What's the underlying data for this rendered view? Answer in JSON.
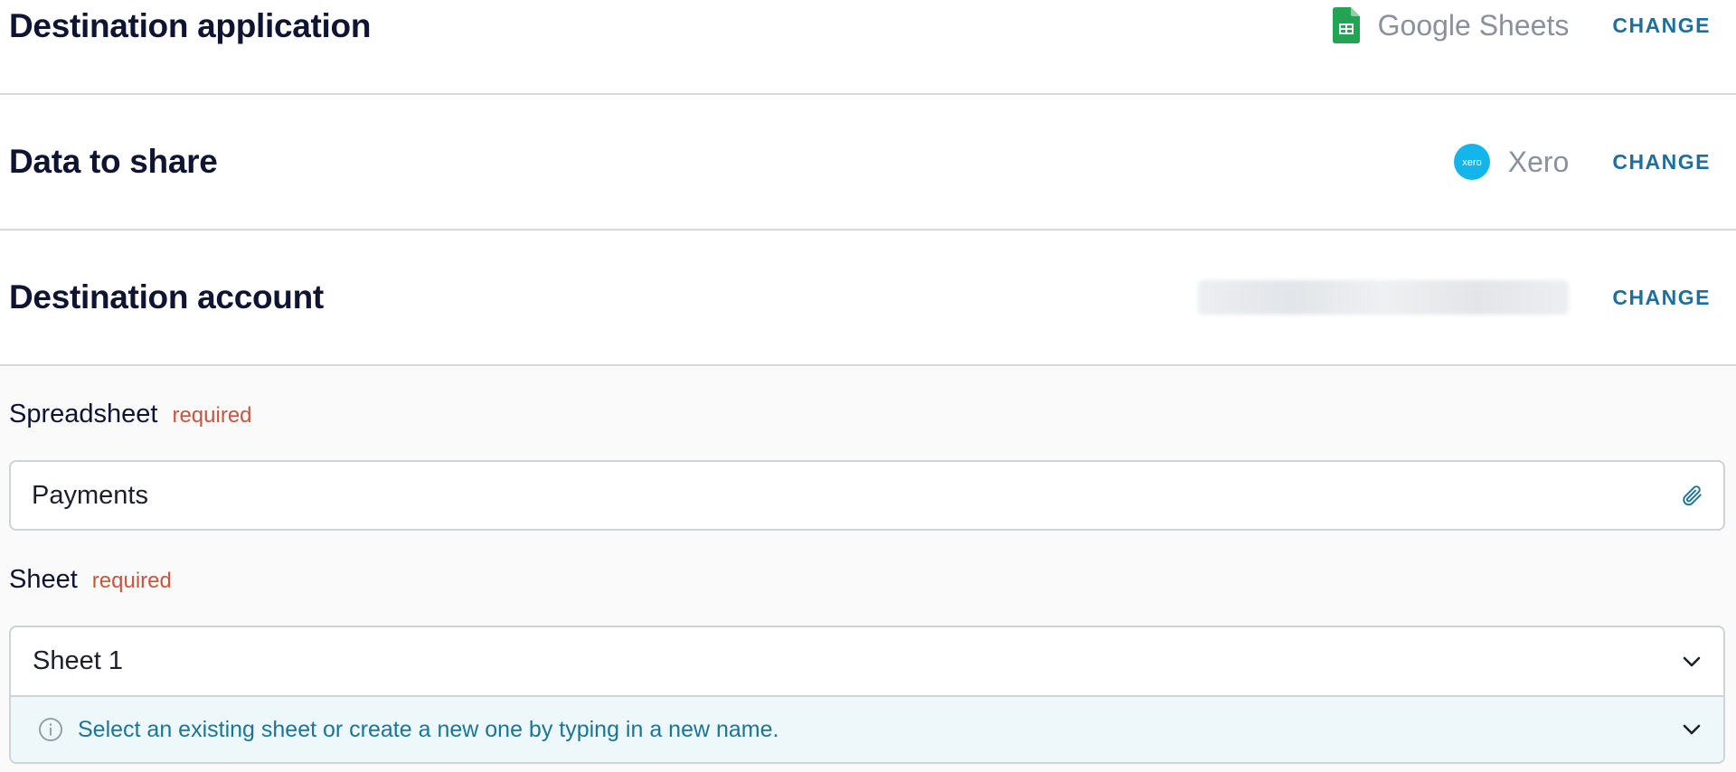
{
  "sections": {
    "destination_application": {
      "title": "Destination application",
      "app_name": "Google Sheets",
      "app_icon": "google-sheets-icon",
      "change_label": "CHANGE"
    },
    "data_to_share": {
      "title": "Data to share",
      "app_name": "Xero",
      "app_icon": "xero-icon",
      "icon_text": "xero",
      "change_label": "CHANGE"
    },
    "destination_account": {
      "title": "Destination account",
      "change_label": "CHANGE"
    }
  },
  "form": {
    "spreadsheet": {
      "label": "Spreadsheet",
      "required_label": "required",
      "value": "Payments",
      "trailing_icon": "paperclip-icon"
    },
    "sheet": {
      "label": "Sheet",
      "required_label": "required",
      "value": "Sheet 1",
      "hint": "Select an existing sheet or create a new one by typing in a new name.",
      "hint_icon": "info-icon"
    }
  },
  "colors": {
    "accent": "#1d6fa0",
    "required": "#c8553d",
    "hint_background": "#eef7fa",
    "hint_text": "#1a7698",
    "sheets_green": "#23a455",
    "xero_blue": "#13b5ea"
  }
}
